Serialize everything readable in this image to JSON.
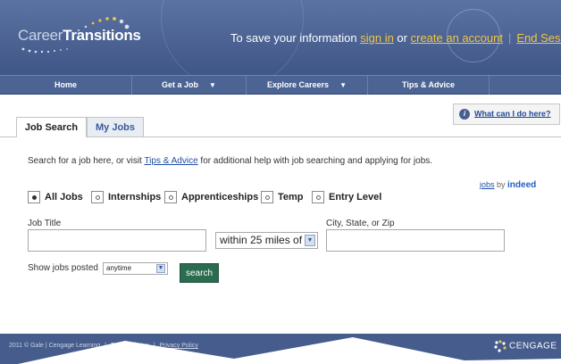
{
  "header": {
    "logo_thin": "Career",
    "logo_bold": "Transitions",
    "save_prefix": "To save your information ",
    "sign_in": "sign in",
    "or_text": " or ",
    "create_account": "create an account",
    "separator": "|",
    "end_session": "End Sessio"
  },
  "nav": {
    "items": [
      {
        "label": "Home",
        "has_caret": false
      },
      {
        "label": "Get a Job",
        "has_caret": true
      },
      {
        "label": "Explore Careers",
        "has_caret": true
      },
      {
        "label": "Tips & Advice",
        "has_caret": false
      }
    ],
    "caret_glyph": "▼"
  },
  "tabs": {
    "job_search": "Job Search",
    "my_jobs": "My Jobs"
  },
  "help": {
    "icon_glyph": "i",
    "label": "What can I do here?"
  },
  "intro": {
    "before": "Search for a job here, or visit ",
    "link": "Tips & Advice",
    "after": " for additional help with job searching and applying for jobs."
  },
  "powered": {
    "jobs": "jobs",
    "by": " by ",
    "indeed": "indeed"
  },
  "job_types": [
    {
      "label": "All Jobs",
      "selected": true
    },
    {
      "label": "Internships",
      "selected": false
    },
    {
      "label": "Apprenticeships",
      "selected": false
    },
    {
      "label": "Temp",
      "selected": false
    },
    {
      "label": "Entry Level",
      "selected": false
    }
  ],
  "form": {
    "job_title_label": "Job Title",
    "job_title_value": "",
    "within_value": "within 25 miles of",
    "location_label": "City, State, or Zip",
    "location_value": "",
    "show_label": "Show jobs posted",
    "posted_value": "anytime",
    "search_label": "search",
    "dropdown_glyph": "▼"
  },
  "footer": {
    "copyright": "2011 © Gale | Cengage Learning",
    "terms": "Terms Of Use",
    "privacy": "Privacy Policy",
    "brand": "CENGAGE"
  },
  "colors": {
    "header_bg": "#4a6192",
    "link_yellow": "#f3c642",
    "search_button": "#2b6b4f",
    "footer_bg": "#465c8c"
  }
}
